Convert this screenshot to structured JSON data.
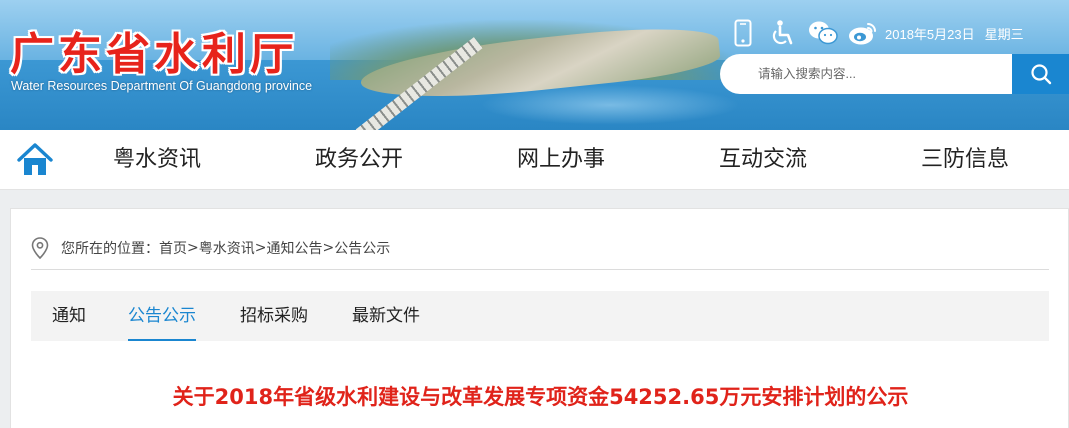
{
  "header": {
    "logo_cn": "广东省水利厅",
    "logo_en": "Water Resources Department Of Guangdong province",
    "date": "2018年5月23日",
    "weekday": "星期三",
    "icons": [
      "mobile-icon",
      "accessibility-icon",
      "wechat-icon",
      "weibo-icon"
    ],
    "search_placeholder": "请输入搜索内容..."
  },
  "nav": {
    "items": [
      "粤水资讯",
      "政务公开",
      "网上办事",
      "互动交流",
      "三防信息"
    ]
  },
  "breadcrumb": {
    "prefix": "您所在的位置：",
    "items": [
      "首页",
      "粤水资讯",
      "通知公告",
      "公告公示"
    ],
    "separator": ">"
  },
  "tabs": {
    "items": [
      "通知",
      "公告公示",
      "招标采购",
      "最新文件"
    ],
    "active_index": 1
  },
  "article": {
    "title": "关于2018年省级水利建设与改革发展专项资金54252.65万元安排计划的公示"
  },
  "colors": {
    "accent": "#1a86d0",
    "title_red": "#e0231a",
    "logo_red": "#e7231b"
  }
}
